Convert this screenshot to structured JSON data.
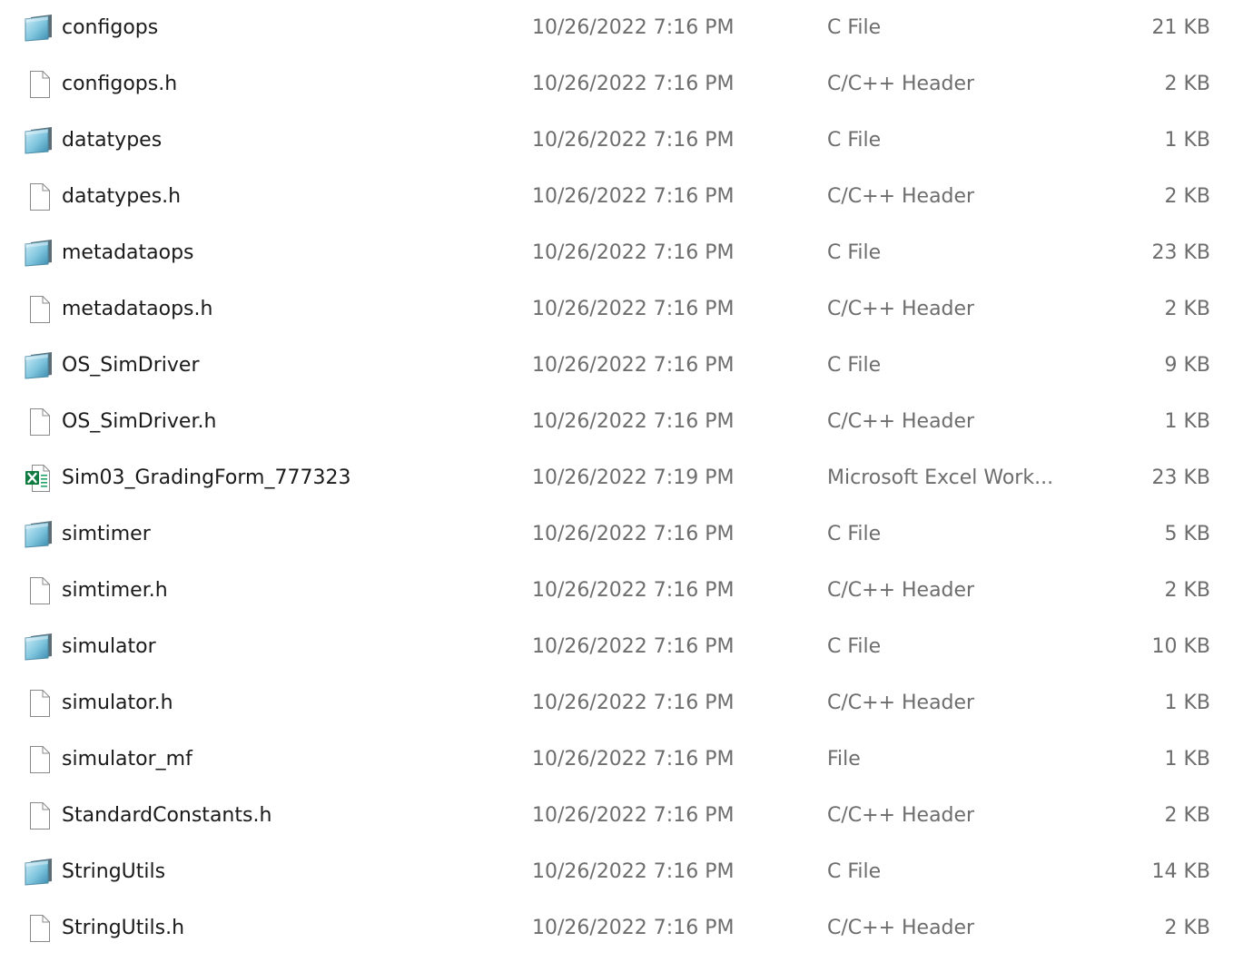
{
  "files": [
    {
      "name": "configops",
      "date": "10/26/2022 7:16 PM",
      "type": "C File",
      "size": "21 KB",
      "icon": "c-file-icon"
    },
    {
      "name": "configops.h",
      "date": "10/26/2022 7:16 PM",
      "type": "C/C++ Header",
      "size": "2 KB",
      "icon": "blank-file-icon"
    },
    {
      "name": "datatypes",
      "date": "10/26/2022 7:16 PM",
      "type": "C File",
      "size": "1 KB",
      "icon": "c-file-icon"
    },
    {
      "name": "datatypes.h",
      "date": "10/26/2022 7:16 PM",
      "type": "C/C++ Header",
      "size": "2 KB",
      "icon": "blank-file-icon"
    },
    {
      "name": "metadataops",
      "date": "10/26/2022 7:16 PM",
      "type": "C File",
      "size": "23 KB",
      "icon": "c-file-icon"
    },
    {
      "name": "metadataops.h",
      "date": "10/26/2022 7:16 PM",
      "type": "C/C++ Header",
      "size": "2 KB",
      "icon": "blank-file-icon"
    },
    {
      "name": "OS_SimDriver",
      "date": "10/26/2022 7:16 PM",
      "type": "C File",
      "size": "9 KB",
      "icon": "c-file-icon"
    },
    {
      "name": "OS_SimDriver.h",
      "date": "10/26/2022 7:16 PM",
      "type": "C/C++ Header",
      "size": "1 KB",
      "icon": "blank-file-icon"
    },
    {
      "name": "Sim03_GradingForm_777323",
      "date": "10/26/2022 7:19 PM",
      "type": "Microsoft Excel Work...",
      "size": "23 KB",
      "icon": "excel-file-icon"
    },
    {
      "name": "simtimer",
      "date": "10/26/2022 7:16 PM",
      "type": "C File",
      "size": "5 KB",
      "icon": "c-file-icon"
    },
    {
      "name": "simtimer.h",
      "date": "10/26/2022 7:16 PM",
      "type": "C/C++ Header",
      "size": "2 KB",
      "icon": "blank-file-icon"
    },
    {
      "name": "simulator",
      "date": "10/26/2022 7:16 PM",
      "type": "C File",
      "size": "10 KB",
      "icon": "c-file-icon"
    },
    {
      "name": "simulator.h",
      "date": "10/26/2022 7:16 PM",
      "type": "C/C++ Header",
      "size": "1 KB",
      "icon": "blank-file-icon"
    },
    {
      "name": "simulator_mf",
      "date": "10/26/2022 7:16 PM",
      "type": "File",
      "size": "1 KB",
      "icon": "blank-file-icon"
    },
    {
      "name": "StandardConstants.h",
      "date": "10/26/2022 7:16 PM",
      "type": "C/C++ Header",
      "size": "2 KB",
      "icon": "blank-file-icon"
    },
    {
      "name": "StringUtils",
      "date": "10/26/2022 7:16 PM",
      "type": "C File",
      "size": "14 KB",
      "icon": "c-file-icon"
    },
    {
      "name": "StringUtils.h",
      "date": "10/26/2022 7:16 PM",
      "type": "C/C++ Header",
      "size": "2 KB",
      "icon": "blank-file-icon"
    }
  ]
}
